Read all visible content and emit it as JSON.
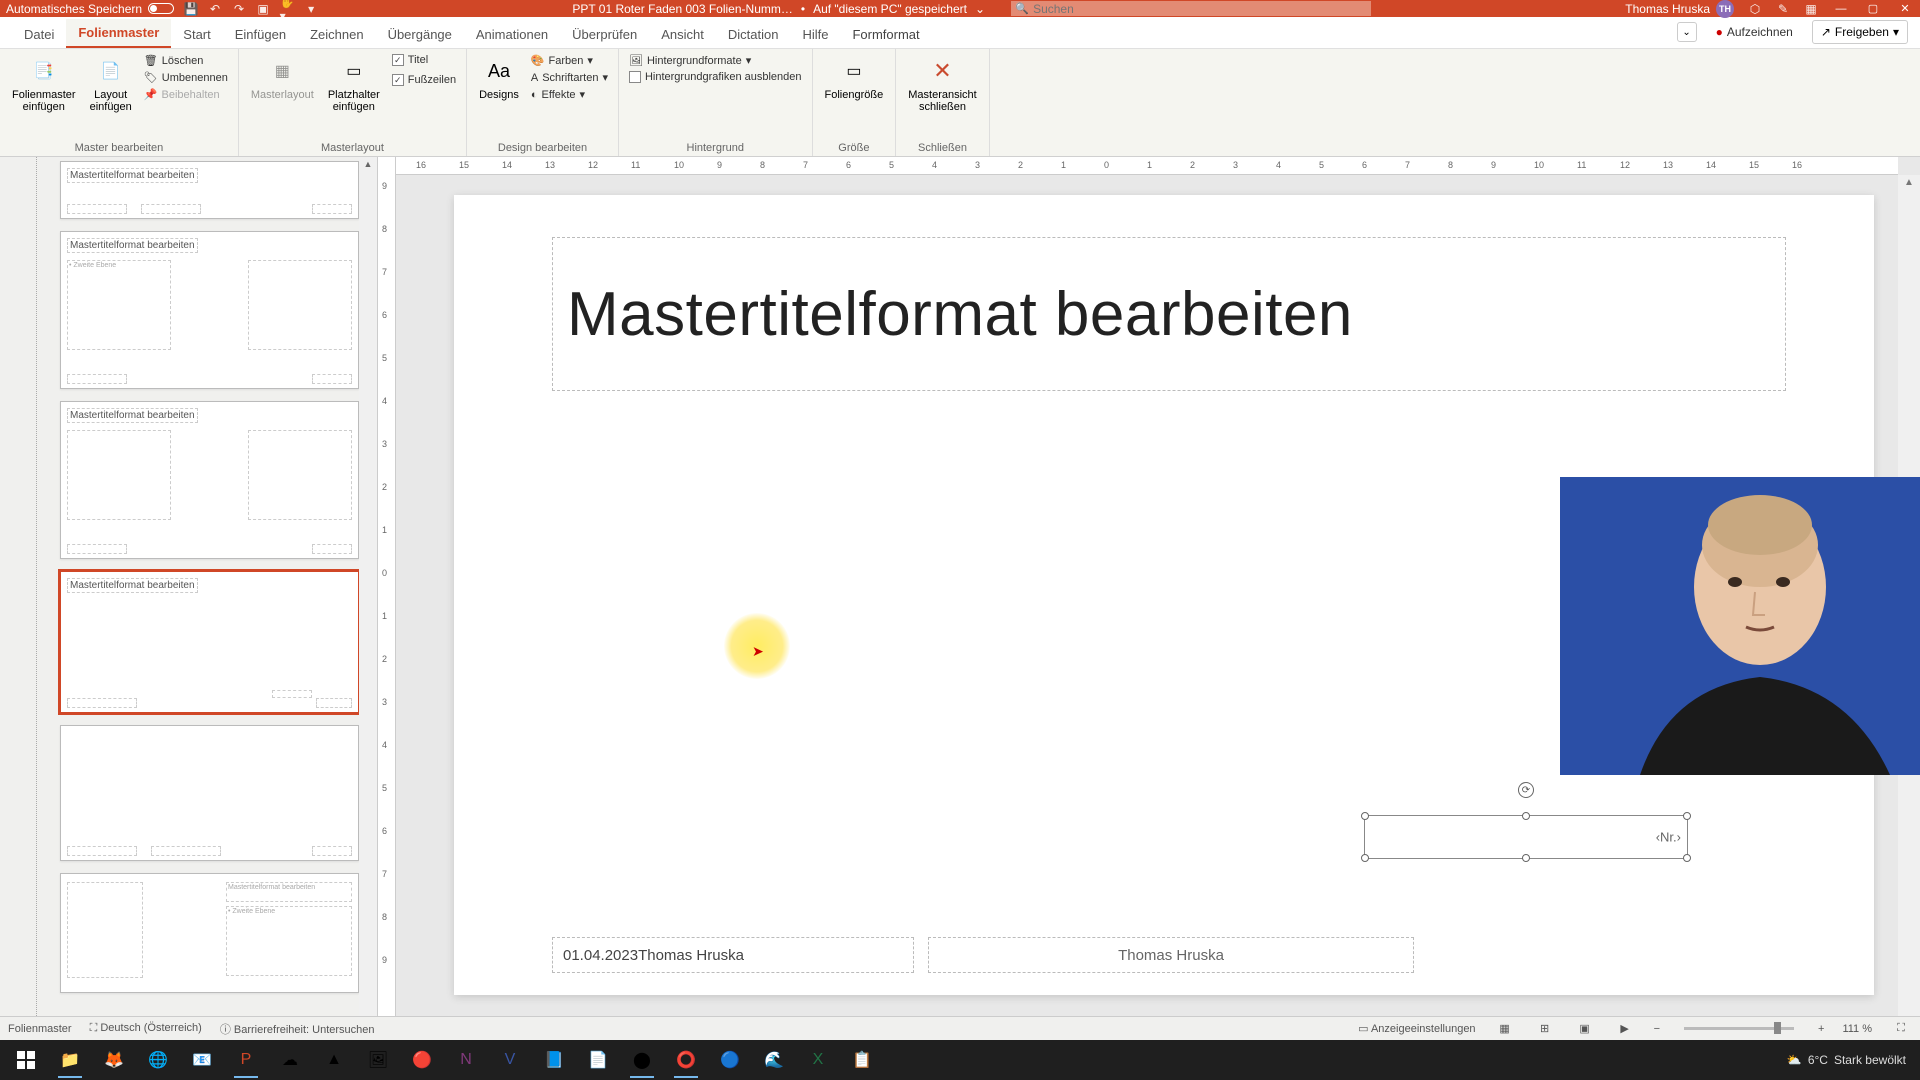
{
  "titlebar": {
    "autosave_label": "Automatisches Speichern",
    "doc_name": "PPT 01 Roter Faden 003 Folien-Numm…",
    "saved_hint": "Auf \"diesem PC\" gespeichert",
    "search_placeholder": "Suchen",
    "user_name": "Thomas Hruska",
    "user_initials": "TH"
  },
  "tabs": {
    "items": [
      "Datei",
      "Folienmaster",
      "Start",
      "Einfügen",
      "Zeichnen",
      "Übergänge",
      "Animationen",
      "Überprüfen",
      "Ansicht",
      "Dictation",
      "Hilfe",
      "Formformat"
    ],
    "active_index": 1,
    "record": "Aufzeichnen",
    "share": "Freigeben"
  },
  "ribbon": {
    "groups": {
      "master_edit": {
        "label": "Master bearbeiten",
        "insert_slide_master": "Folienmaster\neinfügen",
        "insert_layout": "Layout\neinfügen",
        "delete": "Löschen",
        "rename": "Umbenennen",
        "preserve": "Beibehalten"
      },
      "master_layout": {
        "label": "Masterlayout",
        "masterlayout": "Masterlayout",
        "placeholder": "Platzhalter\neinfügen",
        "title_chk": "Titel",
        "footer_chk": "Fußzeilen"
      },
      "edit_design": {
        "label": "Design bearbeiten",
        "designs": "Designs",
        "colors": "Farben",
        "fonts": "Schriftarten",
        "effects": "Effekte"
      },
      "background": {
        "label": "Hintergrund",
        "bg_formats": "Hintergrundformate",
        "hide_bg": "Hintergrundgrafiken ausblenden"
      },
      "size": {
        "label": "Größe",
        "slide_size": "Foliengröße"
      },
      "close": {
        "label": "Schließen",
        "close_master": "Masteransicht\nschließen"
      }
    }
  },
  "slide": {
    "title_placeholder": "Mastertitelformat bearbeiten",
    "date": "01.04.2023",
    "author": "Thomas Hruska",
    "footer_center": "Thomas Hruska",
    "page_nr": "‹Nr.›"
  },
  "thumbnails": {
    "item_title": "Mastertitelformat bearbeiten"
  },
  "statusbar": {
    "mode": "Folienmaster",
    "lang_icon": "⛶",
    "language": "Deutsch (Österreich)",
    "accessibility": "Barrierefreiheit: Untersuchen",
    "display_settings": "Anzeigeeinstellungen",
    "zoom": "111 %"
  },
  "ruler": {
    "h": [
      "16",
      "15",
      "14",
      "13",
      "12",
      "11",
      "10",
      "9",
      "8",
      "7",
      "6",
      "5",
      "4",
      "3",
      "2",
      "1",
      "0",
      "1",
      "2",
      "3",
      "4",
      "5",
      "6",
      "7",
      "8",
      "9",
      "10",
      "11",
      "12",
      "13",
      "14",
      "15",
      "16"
    ],
    "v": [
      "9",
      "8",
      "7",
      "6",
      "5",
      "4",
      "3",
      "2",
      "1",
      "0",
      "1",
      "2",
      "3",
      "4",
      "5",
      "6",
      "7",
      "8",
      "9"
    ]
  },
  "taskbar": {
    "weather_temp": "6°C",
    "weather_text": "Stark bewölkt"
  }
}
